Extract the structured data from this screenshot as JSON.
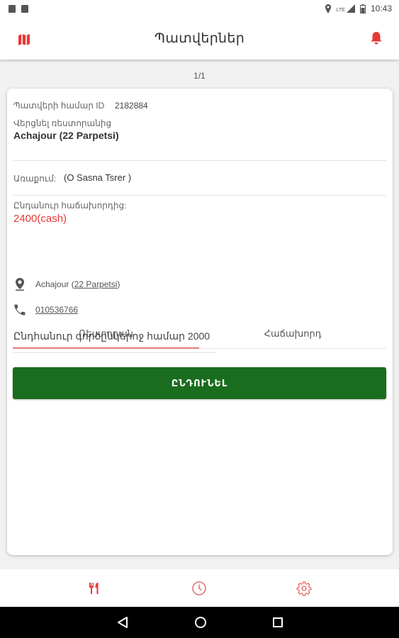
{
  "status_bar": {
    "time": "10:43",
    "network": "LTE"
  },
  "app_bar": {
    "title": "Պատվերներ",
    "left_icon": "map-icon",
    "right_icon": "bell-icon",
    "accent_color": "#e53935"
  },
  "pager": {
    "text": "1/1"
  },
  "order": {
    "id_label": "Պատվերի համար ID",
    "id_value": "2182884",
    "pickup_label": "Վերցնել ռեստորանից",
    "pickup_value": "Achajour (22 Parpetsi)",
    "delivery_label": "Առաքում:",
    "delivery_value": "(O Sasna Tsrer )",
    "total_label": "Ընդանուր հաճախորդից:",
    "total_value": "2400(cash)",
    "total_color": "#e53935"
  },
  "tabs": [
    {
      "label": "Ռեստորան",
      "active": true
    },
    {
      "label": "Հաճախորդ",
      "active": false
    }
  ],
  "restaurant_info": {
    "address_prefix": "Achajour (",
    "address_link": "22 Parpetsi",
    "address_suffix": ")",
    "phone": "010536766",
    "summary": "Ընդհանուր գործընկերոջ համար 2000"
  },
  "accept_button": {
    "label": "ԸՆԴՈՒՆԵԼ",
    "color": "#1a6d1e"
  },
  "bottom_nav": {
    "items": [
      "restaurant-icon",
      "clock-icon",
      "settings-icon"
    ]
  }
}
